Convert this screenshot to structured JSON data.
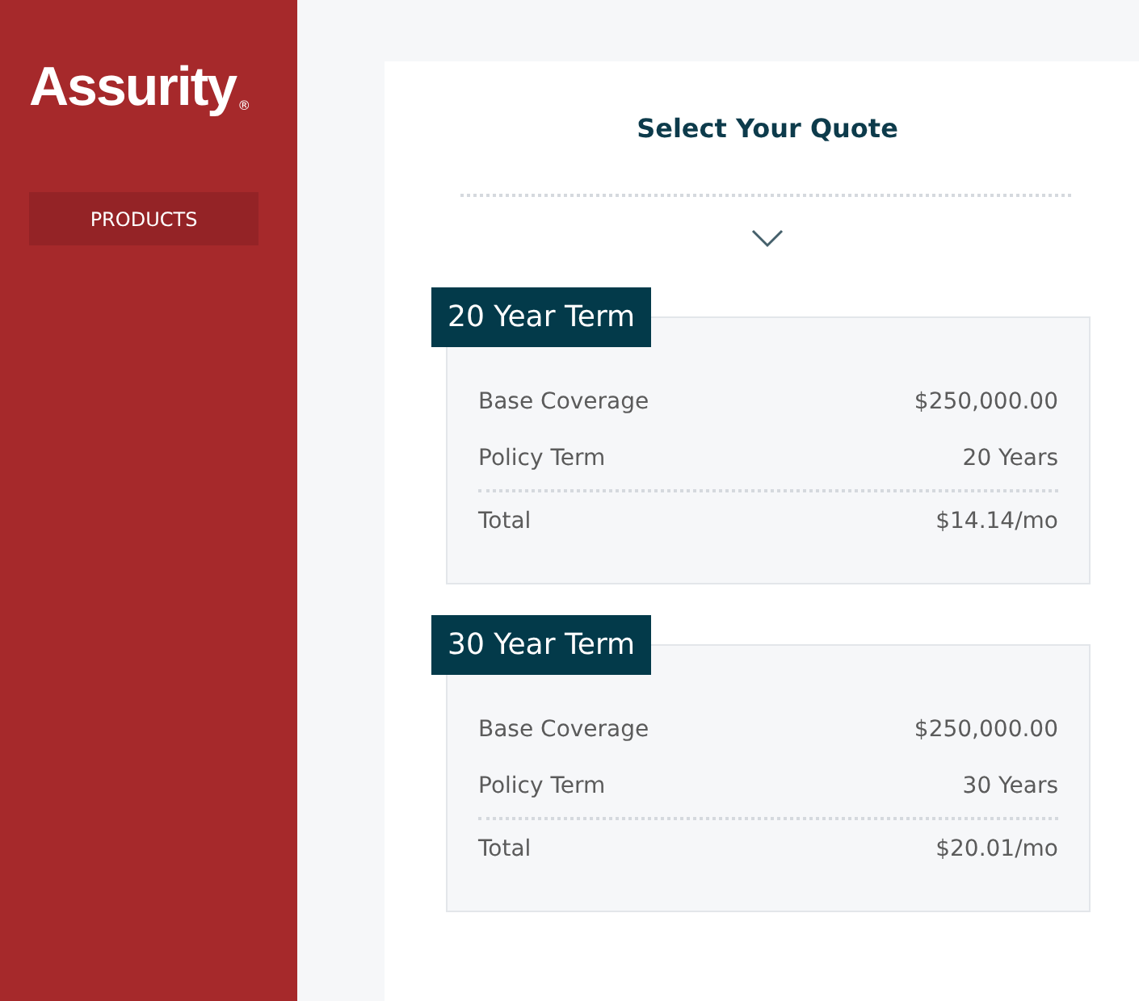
{
  "sidebar": {
    "logo": "Assurity",
    "logo_mark": "®",
    "nav": [
      {
        "label": "PRODUCTS"
      }
    ]
  },
  "main": {
    "title": "Select Your Quote",
    "quotes": [
      {
        "name": "20 Year Term",
        "rows": [
          {
            "label": "Base Coverage",
            "value": "$250,000.00"
          },
          {
            "label": "Policy Term",
            "value": "20 Years"
          }
        ],
        "total": {
          "label": "Total",
          "value": "$14.14/mo"
        }
      },
      {
        "name": "30 Year Term",
        "rows": [
          {
            "label": "Base Coverage",
            "value": "$250,000.00"
          },
          {
            "label": "Policy Term",
            "value": "30 Years"
          }
        ],
        "total": {
          "label": "Total",
          "value": "$20.01/mo"
        }
      }
    ]
  }
}
